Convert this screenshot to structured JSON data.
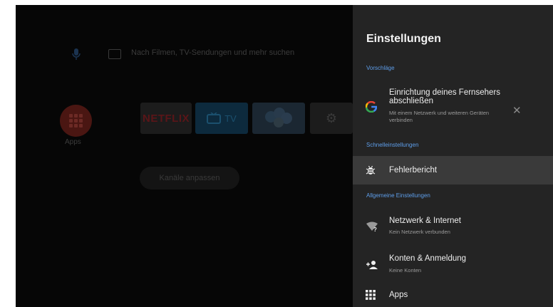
{
  "home": {
    "search_placeholder": "Nach Filmen, TV-Sendungen und mehr suchen",
    "apps_label": "Apps",
    "netflix_label": "NETFLIX",
    "tv_label": "TV",
    "channels_button": "Kanäle anpassen"
  },
  "settings": {
    "title": "Einstellungen",
    "section_suggestions": "Vorschläge",
    "suggestion_title": "Einrichtung deines Fernsehers abschließen",
    "suggestion_subtitle": "Mit einem Netzwerk und weiteren Geräten verbinden",
    "suggestion_icon": "google-icon",
    "section_quick": "Schnelleinstellungen",
    "bug_report": "Fehlerbericht",
    "section_general": "Allgemeine Einstellungen",
    "network_title": "Netzwerk & Internet",
    "network_subtitle": "Kein Netzwerk verbunden",
    "accounts_title": "Konten & Anmeldung",
    "accounts_subtitle": "Keine Konten",
    "apps_title": "Apps",
    "accent_color": "#5e9eea"
  }
}
